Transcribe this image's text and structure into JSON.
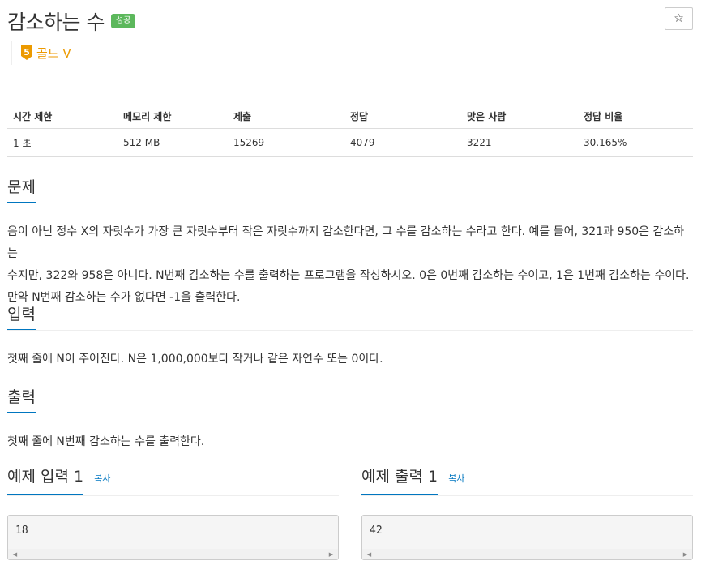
{
  "problem": {
    "title": "감소하는 수",
    "status_badge": "성공",
    "tier": {
      "number": "5",
      "label": "골드 V",
      "color": "#ec9a00"
    },
    "star_icon": "☆"
  },
  "stats": {
    "headers": [
      "시간 제한",
      "메모리 제한",
      "제출",
      "정답",
      "맞은 사람",
      "정답 비율"
    ],
    "values": [
      "1 초",
      "512 MB",
      "15269",
      "4079",
      "3221",
      "30.165%"
    ]
  },
  "sections": {
    "problem": {
      "title": "문제",
      "lines": [
        "음이 아닌 정수 X의 자릿수가 가장 큰 자릿수부터 작은 자릿수까지 감소한다면, 그 수를 감소하는 수라고 한다. 예를 들어, 321과 950은 감소하는",
        "수지만, 322와 958은 아니다. N번째 감소하는 수를 출력하는 프로그램을 작성하시오. 0은 0번째 감소하는 수이고, 1은 1번째 감소하는 수이다.",
        "만약 N번째 감소하는 수가 없다면 -1을 출력한다."
      ]
    },
    "input": {
      "title": "입력",
      "text": "첫째 줄에 N이 주어진다. N은 1,000,000보다 작거나 같은 자연수 또는 0이다."
    },
    "output": {
      "title": "출력",
      "text": "첫째 줄에 N번째 감소하는 수를 출력한다."
    }
  },
  "samples": {
    "input": {
      "title": "예제 입력 1",
      "copy": "복사",
      "value": "18"
    },
    "output": {
      "title": "예제 출력 1",
      "copy": "복사",
      "value": "42"
    }
  },
  "colors": {
    "accent": "#0076c0",
    "success": "#5cb85c",
    "gold": "#ec9a00"
  }
}
